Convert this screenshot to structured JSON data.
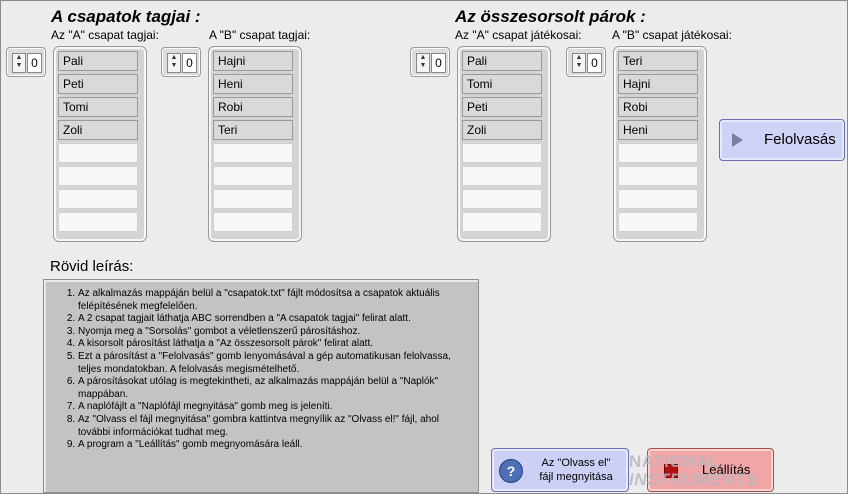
{
  "headers": {
    "left": "A csapatok tagjai :",
    "right": "Az összesorsolt párok :"
  },
  "arrays": [
    {
      "label": "Az \"A\" csapat tagjai:",
      "index": "0",
      "items": [
        "Pali",
        "Peti",
        "Tomi",
        "Zoli"
      ]
    },
    {
      "label": "A \"B\" csapat tagjai:",
      "index": "0",
      "items": [
        "Hajni",
        "Heni",
        "Robi",
        "Teri"
      ]
    },
    {
      "label": "Az \"A\" csapat játékosai:",
      "index": "0",
      "items": [
        "Pali",
        "Tomi",
        "Peti",
        "Zoli"
      ]
    },
    {
      "label": "A \"B\" csapat játékosai:",
      "index": "0",
      "items": [
        "Teri",
        "Hajni",
        "Robi",
        "Heni"
      ]
    }
  ],
  "felolvasas_label": "Felolvasás",
  "description": {
    "title": "Rövid leírás:",
    "items": [
      "Az alkalmazás mappáján belül a \"csapatok.txt\" fájlt módosítsa a csapatok aktuális felépítésének megfelelően.",
      "A 2 csapat tagjait láthatja ABC sorrendben a \"A csapatok tagjai\" felirat alatt.",
      "Nyomja meg a \"Sorsolás\" gombot a véletlenszerű párosításhoz.",
      "A kisorsolt párosítást láthatja a \"Az összesorsolt párok\" felirat alatt.",
      "Ezt a párosítást a \"Felolvasás\" gomb lenyomásával a gép automatikusan felolvassa, teljes mondatokban.  A felolvasás megismételhető.",
      "A párosításokat utólag is megtekintheti, az alkalmazás mappáján belül a \"Naplók\" mappában.",
      "A naplófájlt a \"Naplófájl megnyitása\" gomb meg is jeleníti.",
      "Az \"Olvass el fájl megnyitása\" gombra kattintva megnyílik az \"Olvass el!\" fájl, ahol további információkat tudhat meg.",
      "A program a \"Leállítás\" gomb megnyomására leáll."
    ]
  },
  "olvass_button": {
    "line1": "Az \"Olvass el\"",
    "line2": "fájl megnyitása",
    "icon": "question-icon"
  },
  "leallitas_label": "Leállítás",
  "watermark": {
    "line1": "NATIONAL",
    "line2": "INSTRUMENTS"
  }
}
